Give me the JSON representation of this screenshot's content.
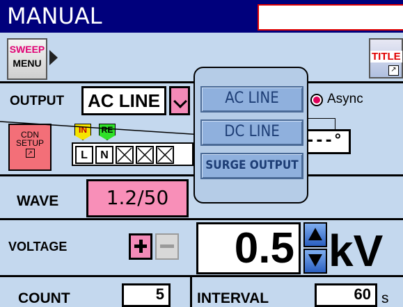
{
  "screen": {
    "title": "MANUAL"
  },
  "sweep_menu": {
    "line1": "SWEEP",
    "line2": "MENU"
  },
  "title_button": {
    "label": "TITLE"
  },
  "output": {
    "label": "OUTPUT",
    "value": "AC LINE"
  },
  "async": {
    "label": "Async"
  },
  "cdn_setup": {
    "line1": "CDN",
    "line2": "SETUP"
  },
  "coupling": {
    "tags": [
      "IN",
      "RE"
    ],
    "terminals": [
      "L",
      "N"
    ]
  },
  "phase": {
    "value": "---°"
  },
  "wave": {
    "label": "WAVE",
    "value": "1.2/50"
  },
  "voltage": {
    "label": "VOLTAGE",
    "value": "0.5",
    "unit": "kV"
  },
  "count": {
    "label": "COUNT",
    "value": "5"
  },
  "interval": {
    "label": "INTERVAL",
    "value": "60",
    "unit": "s"
  },
  "output_menu": {
    "items": [
      "AC LINE",
      "DC LINE",
      "SURGE OUTPUT"
    ]
  },
  "colors": {
    "title_bar": "#00007c",
    "background": "#c4d8ee",
    "accent_pink": "#f38ab8",
    "cdn_red": "#f36f78"
  }
}
